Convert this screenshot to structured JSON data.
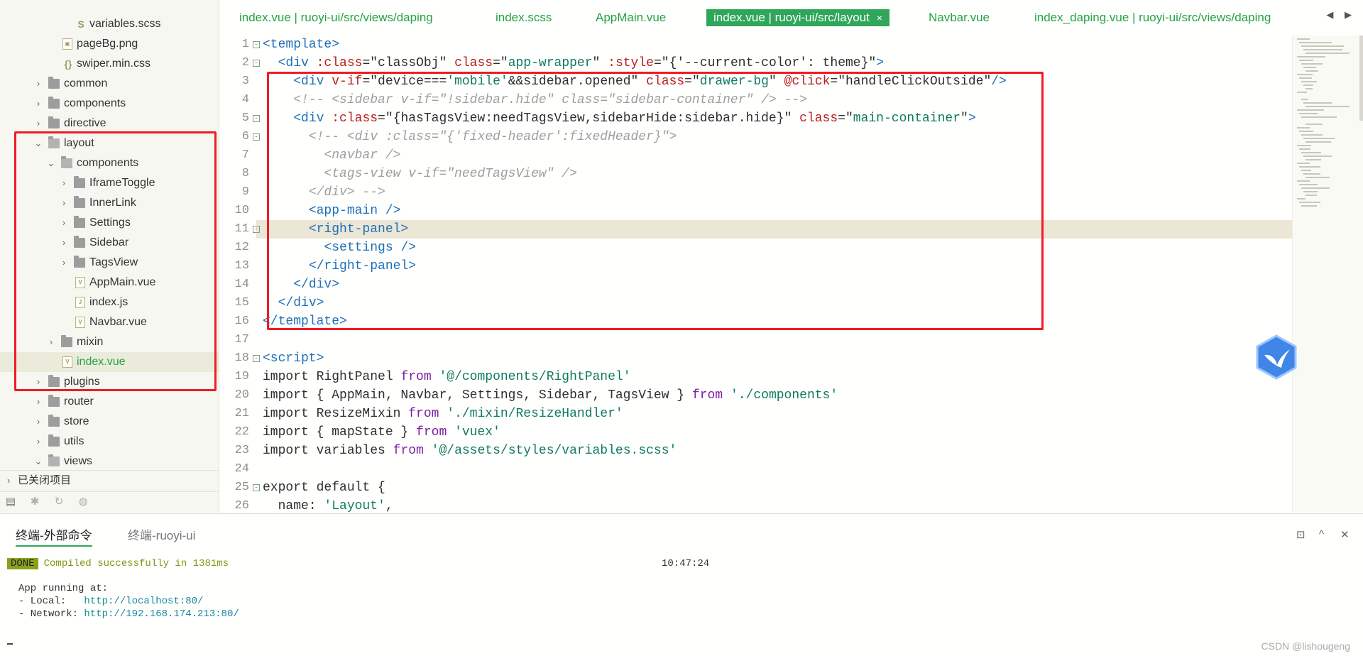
{
  "sidebar": {
    "tree": [
      {
        "label": "variables.scss",
        "type": "scss",
        "depth": 4,
        "expanded": null
      },
      {
        "label": "pageBg.png",
        "type": "image",
        "depth": 3,
        "expanded": null
      },
      {
        "label": "swiper.min.css",
        "type": "css",
        "depth": 3,
        "expanded": null
      },
      {
        "label": "common",
        "type": "folder",
        "depth": 2,
        "expanded": false
      },
      {
        "label": "components",
        "type": "folder",
        "depth": 2,
        "expanded": false
      },
      {
        "label": "directive",
        "type": "folder",
        "depth": 2,
        "expanded": false
      },
      {
        "label": "layout",
        "type": "folder",
        "depth": 2,
        "expanded": true
      },
      {
        "label": "components",
        "type": "folder",
        "depth": 3,
        "expanded": true
      },
      {
        "label": "IframeToggle",
        "type": "folder",
        "depth": 4,
        "expanded": false
      },
      {
        "label": "InnerLink",
        "type": "folder",
        "depth": 4,
        "expanded": false
      },
      {
        "label": "Settings",
        "type": "folder",
        "depth": 4,
        "expanded": false
      },
      {
        "label": "Sidebar",
        "type": "folder",
        "depth": 4,
        "expanded": false
      },
      {
        "label": "TagsView",
        "type": "folder",
        "depth": 4,
        "expanded": false
      },
      {
        "label": "AppMain.vue",
        "type": "vue",
        "depth": 4,
        "expanded": null
      },
      {
        "label": "index.js",
        "type": "js",
        "depth": 4,
        "expanded": null
      },
      {
        "label": "Navbar.vue",
        "type": "vue",
        "depth": 4,
        "expanded": null
      },
      {
        "label": "mixin",
        "type": "folder",
        "depth": 3,
        "expanded": false
      },
      {
        "label": "index.vue",
        "type": "vue",
        "depth": 3,
        "expanded": null,
        "selected": true
      },
      {
        "label": "plugins",
        "type": "folder",
        "depth": 2,
        "expanded": false
      },
      {
        "label": "router",
        "type": "folder",
        "depth": 2,
        "expanded": false
      },
      {
        "label": "store",
        "type": "folder",
        "depth": 2,
        "expanded": false
      },
      {
        "label": "utils",
        "type": "folder",
        "depth": 2,
        "expanded": false
      },
      {
        "label": "views",
        "type": "folder",
        "depth": 2,
        "expanded": true
      }
    ],
    "closed_projects": "已关闭项目",
    "tools": [
      "explorer-icon",
      "bug-icon",
      "git-icon",
      "globe-icon"
    ]
  },
  "tabs": [
    {
      "label": "index.vue | ruoyi-ui/src/views/daping"
    },
    {
      "label": "index.scss"
    },
    {
      "label": "AppMain.vue"
    },
    {
      "label": "index.vue | ruoyi-ui/src/layout",
      "active": true,
      "close": "×"
    },
    {
      "label": "Navbar.vue"
    },
    {
      "label": "index_daping.vue | ruoyi-ui/src/views/daping"
    }
  ],
  "tab_arrows": "◀ ▶",
  "editor": {
    "lines": [
      {
        "n": "1",
        "fold": "-",
        "tokens": [
          [
            "tag",
            "<template>"
          ]
        ]
      },
      {
        "n": "2",
        "fold": "-",
        "tokens": [
          [
            "plain",
            "  "
          ],
          [
            "tag",
            "<div "
          ],
          [
            "attr",
            ":class"
          ],
          [
            "plain",
            "=\""
          ],
          [
            "plain",
            "classObj"
          ],
          [
            "plain",
            "\" "
          ],
          [
            "attr",
            "class"
          ],
          [
            "plain",
            "=\""
          ],
          [
            "str",
            "app-wrapper"
          ],
          [
            "plain",
            "\" "
          ],
          [
            "attr",
            ":style"
          ],
          [
            "plain",
            "=\""
          ],
          [
            "plain",
            "{'--current-color': theme}"
          ],
          [
            "plain",
            "\""
          ],
          [
            "tag",
            ">"
          ]
        ]
      },
      {
        "n": "3",
        "fold": "",
        "tokens": [
          [
            "plain",
            "    "
          ],
          [
            "tag",
            "<div "
          ],
          [
            "attr",
            "v-if"
          ],
          [
            "plain",
            "=\"device==="
          ],
          [
            "str",
            "'mobile'"
          ],
          [
            "plain",
            "&&sidebar.opened\" "
          ],
          [
            "attr",
            "class"
          ],
          [
            "plain",
            "=\""
          ],
          [
            "str",
            "drawer-bg"
          ],
          [
            "plain",
            "\" "
          ],
          [
            "attr",
            "@click"
          ],
          [
            "plain",
            "=\"handleClickOutside\""
          ],
          [
            "tag",
            "/>"
          ]
        ]
      },
      {
        "n": "4",
        "fold": "",
        "tokens": [
          [
            "plain",
            "    "
          ],
          [
            "com",
            "<!-- <sidebar v-if=\"!sidebar.hide\" class=\"sidebar-container\" /> -->"
          ]
        ]
      },
      {
        "n": "5",
        "fold": "-",
        "tokens": [
          [
            "plain",
            "    "
          ],
          [
            "tag",
            "<div "
          ],
          [
            "attr",
            ":class"
          ],
          [
            "plain",
            "=\"{hasTagsView:needTagsView,sidebarHide:sidebar.hide}\" "
          ],
          [
            "attr",
            "class"
          ],
          [
            "plain",
            "=\""
          ],
          [
            "str",
            "main-container"
          ],
          [
            "plain",
            "\""
          ],
          [
            "tag",
            ">"
          ]
        ]
      },
      {
        "n": "6",
        "fold": "-",
        "tokens": [
          [
            "plain",
            "      "
          ],
          [
            "com",
            "<!-- <div :class=\"{'fixed-header':fixedHeader}\">"
          ]
        ]
      },
      {
        "n": "7",
        "fold": "",
        "tokens": [
          [
            "plain",
            "        "
          ],
          [
            "com",
            "<navbar />"
          ]
        ]
      },
      {
        "n": "8",
        "fold": "",
        "tokens": [
          [
            "plain",
            "        "
          ],
          [
            "com",
            "<tags-view v-if=\"needTagsView\" />"
          ]
        ]
      },
      {
        "n": "9",
        "fold": "",
        "tokens": [
          [
            "plain",
            "      "
          ],
          [
            "com",
            "</div> -->"
          ]
        ]
      },
      {
        "n": "10",
        "fold": "",
        "tokens": [
          [
            "plain",
            "      "
          ],
          [
            "tag",
            "<app-main />"
          ]
        ]
      },
      {
        "n": "11",
        "fold": "-",
        "hl": true,
        "tokens": [
          [
            "plain",
            "      "
          ],
          [
            "tag",
            "<right-panel>"
          ]
        ]
      },
      {
        "n": "12",
        "fold": "",
        "tokens": [
          [
            "plain",
            "        "
          ],
          [
            "tag",
            "<settings />"
          ]
        ]
      },
      {
        "n": "13",
        "fold": "",
        "tokens": [
          [
            "plain",
            "      "
          ],
          [
            "tag",
            "</right-panel>"
          ]
        ]
      },
      {
        "n": "14",
        "fold": "",
        "tokens": [
          [
            "plain",
            "    "
          ],
          [
            "tag",
            "</div>"
          ]
        ]
      },
      {
        "n": "15",
        "fold": "",
        "tokens": [
          [
            "plain",
            "  "
          ],
          [
            "tag",
            "</div>"
          ]
        ]
      },
      {
        "n": "16",
        "fold": "",
        "tokens": [
          [
            "tag",
            "</template>"
          ]
        ]
      },
      {
        "n": "17",
        "fold": "",
        "tokens": []
      },
      {
        "n": "18",
        "fold": "-",
        "tokens": [
          [
            "tag",
            "<script>"
          ]
        ]
      },
      {
        "n": "19",
        "fold": "",
        "tokens": [
          [
            "plain",
            "import RightPanel "
          ],
          [
            "kw",
            "from"
          ],
          [
            "plain",
            " "
          ],
          [
            "str",
            "'@/components/RightPanel'"
          ]
        ]
      },
      {
        "n": "20",
        "fold": "",
        "tokens": [
          [
            "plain",
            "import { AppMain, Navbar, Settings, Sidebar, TagsView } "
          ],
          [
            "kw",
            "from"
          ],
          [
            "plain",
            " "
          ],
          [
            "str",
            "'./components'"
          ]
        ]
      },
      {
        "n": "21",
        "fold": "",
        "tokens": [
          [
            "plain",
            "import ResizeMixin "
          ],
          [
            "kw",
            "from"
          ],
          [
            "plain",
            " "
          ],
          [
            "str",
            "'./mixin/ResizeHandler'"
          ]
        ]
      },
      {
        "n": "22",
        "fold": "",
        "tokens": [
          [
            "plain",
            "import { mapState } "
          ],
          [
            "kw",
            "from"
          ],
          [
            "plain",
            " "
          ],
          [
            "str",
            "'vuex'"
          ]
        ]
      },
      {
        "n": "23",
        "fold": "",
        "tokens": [
          [
            "plain",
            "import variables "
          ],
          [
            "kw",
            "from"
          ],
          [
            "plain",
            " "
          ],
          [
            "str",
            "'@/assets/styles/variables.scss'"
          ]
        ]
      },
      {
        "n": "24",
        "fold": "",
        "tokens": []
      },
      {
        "n": "25",
        "fold": "-",
        "tokens": [
          [
            "plain",
            "export default {"
          ]
        ]
      },
      {
        "n": "26",
        "fold": "",
        "tokens": [
          [
            "plain",
            "  name: "
          ],
          [
            "str",
            "'Layout'"
          ],
          [
            "plain",
            ","
          ]
        ]
      }
    ]
  },
  "terminal": {
    "tabs": [
      {
        "label": "终端-外部命令",
        "active": true
      },
      {
        "label": "终端-ruoyi-ui",
        "active": false
      }
    ],
    "controls": [
      "⊡",
      "^",
      "✕"
    ],
    "done_badge": "DONE",
    "compiled": "Compiled successfully in 1381ms",
    "time": "10:47:24",
    "app_running": "App running at:",
    "local_label": "- Local:   ",
    "local_url": "http://localhost:80/",
    "network_label": "- Network: ",
    "network_url": "http://192.168.174.213:80/"
  },
  "watermark": "CSDN @lishougeng",
  "colors": {
    "accent": "#2fa65a",
    "annotation": "#ee1c24",
    "selected_text": "#25a244"
  }
}
